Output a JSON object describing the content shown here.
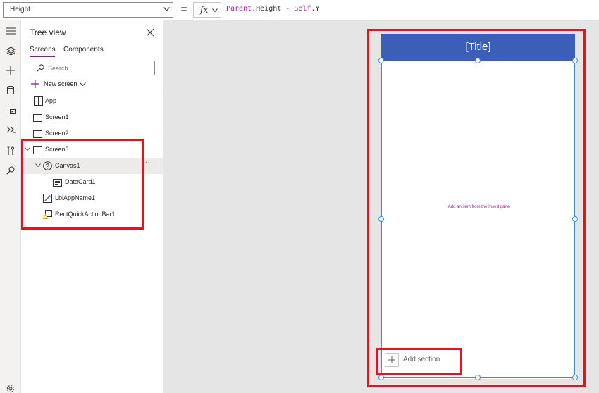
{
  "formula_bar": {
    "property": "Height",
    "equals": "=",
    "fx_label": "fx",
    "formula": {
      "part1": "Parent",
      "part2": ".Height - ",
      "part3": "Self",
      "part4": ".Y"
    }
  },
  "rail": {
    "icons": [
      "hamburger-icon",
      "layers-icon",
      "plus-icon",
      "database-icon",
      "media-icon",
      "variables-icon",
      "tools-icon",
      "search-icon",
      "settings-icon"
    ]
  },
  "tree": {
    "title": "Tree view",
    "tabs": {
      "screens": "Screens",
      "components": "Components"
    },
    "search_placeholder": "Search",
    "new_screen": "New screen",
    "items": {
      "app": "App",
      "screen1": "Screen1",
      "screen2": "Screen2",
      "screen3": "Screen3",
      "canvas1": "Canvas1",
      "datacard1": "DataCard1",
      "lblappname1": "LblAppName1",
      "rectquickactionbar1": "RectQuickActionBar1"
    },
    "more": "···"
  },
  "canvas": {
    "title": "[Title]",
    "empty_hint": "Add an item from the Insert pane",
    "add_section": "Add section"
  },
  "colors": {
    "accent": "#742774",
    "title_bar": "#3b5eb7",
    "selection": "#3b8ed6",
    "highlight": "#e81123",
    "formula_keyword": "#a4228a"
  }
}
